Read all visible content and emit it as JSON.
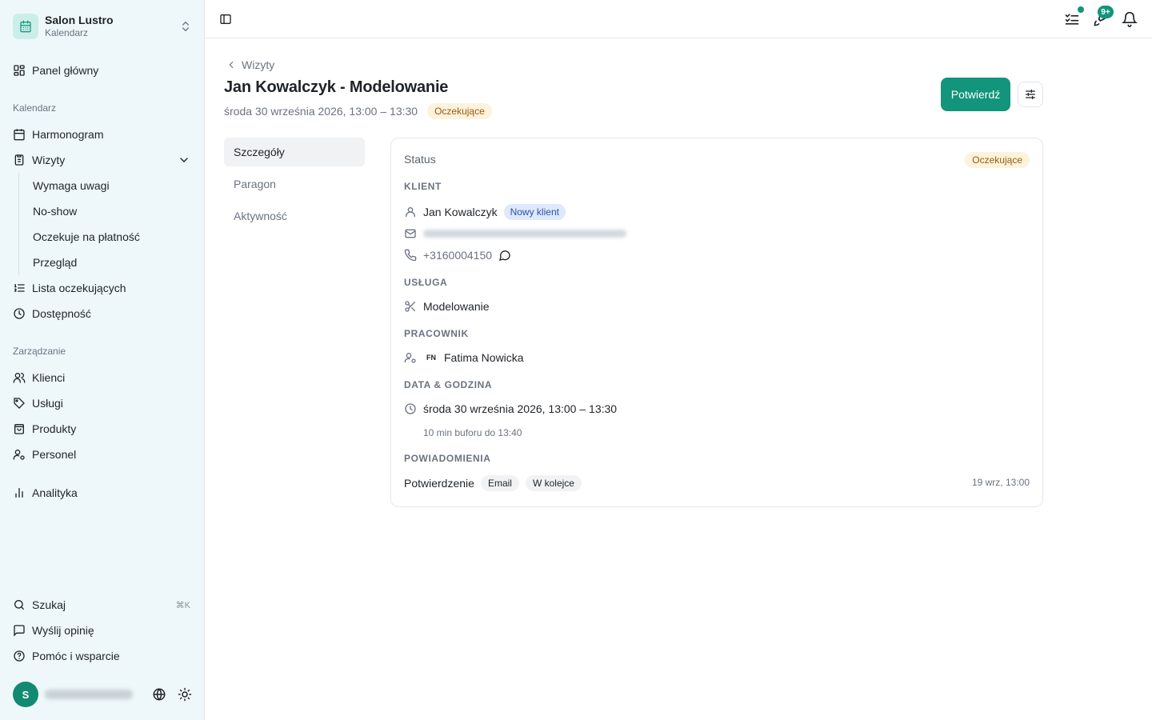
{
  "colors": {
    "accent": "#12957a",
    "sidebar_bg": "#eef8fb",
    "pending_bg": "#fdf2dc",
    "pending_text": "#9a5a10",
    "new_client_bg": "#dfe9fb",
    "new_client_text": "#2a50a8"
  },
  "org": {
    "name": "Salon Lustro",
    "subtitle": "Kalendarz",
    "icon": "calendar-icon"
  },
  "sidebar": {
    "dashboard": {
      "label": "Panel główny",
      "icon": "dashboard-icon"
    },
    "calendar_section": "Kalendarz",
    "schedule": {
      "label": "Harmonogram",
      "icon": "calendar-icon"
    },
    "visits": {
      "label": "Wizyty",
      "icon": "clipboard-icon"
    },
    "visits_sub": [
      "Wymaga uwagi",
      "No-show",
      "Oczekuje na płatność",
      "Przegląd"
    ],
    "waitlist": {
      "label": "Lista oczekujących",
      "icon": "list-ordered-icon"
    },
    "availability": {
      "label": "Dostępność",
      "icon": "clock-icon"
    },
    "management_section": "Zarządzanie",
    "clients": {
      "label": "Klienci",
      "icon": "users-icon"
    },
    "services": {
      "label": "Usługi",
      "icon": "tag-icon"
    },
    "products": {
      "label": "Produkty",
      "icon": "shopping-bag-icon"
    },
    "staff": {
      "label": "Personel",
      "icon": "user-cog-icon"
    },
    "analytics": {
      "label": "Analityka",
      "icon": "bar-chart-icon"
    },
    "search": {
      "label": "Szukaj",
      "shortcut": "⌘K"
    },
    "feedback": {
      "label": "Wyślij opinię"
    },
    "help": {
      "label": "Pomóc i wsparcie"
    },
    "user": {
      "initial": "S"
    }
  },
  "topbar": {
    "notifications_badge": "9+"
  },
  "page": {
    "breadcrumb": "Wizyty",
    "title": "Jan Kowalczyk - Modelowanie",
    "subtitle": "środa 30 września 2026, 13:00 – 13:30",
    "status": "Oczekujące",
    "confirm_label": "Potwierdź"
  },
  "tabs": [
    "Szczegóły",
    "Paragon",
    "Aktywność"
  ],
  "card": {
    "status_label": "Status",
    "status_value": "Oczekujące",
    "client_section": "KLIENT",
    "client_name": "Jan Kowalczyk",
    "client_badge": "Nowy klient",
    "client_phone": "+3160004150",
    "service_section": "USŁUGA",
    "service_name": "Modelowanie",
    "staff_section": "PRACOWNIK",
    "staff_initials": "FN",
    "staff_name": "Fatima Nowicka",
    "datetime_section": "DATA & GODZINA",
    "datetime_value": "środa 30 września 2026, 13:00 – 13:30",
    "buffer_note": "10 min buforu do 13:40",
    "notifications_section": "POWIADOMIENIA",
    "notification_type": "Potwierdzenie",
    "notification_channel": "Email",
    "notification_status": "W kolejce",
    "notification_time": "19 wrz, 13:00"
  }
}
